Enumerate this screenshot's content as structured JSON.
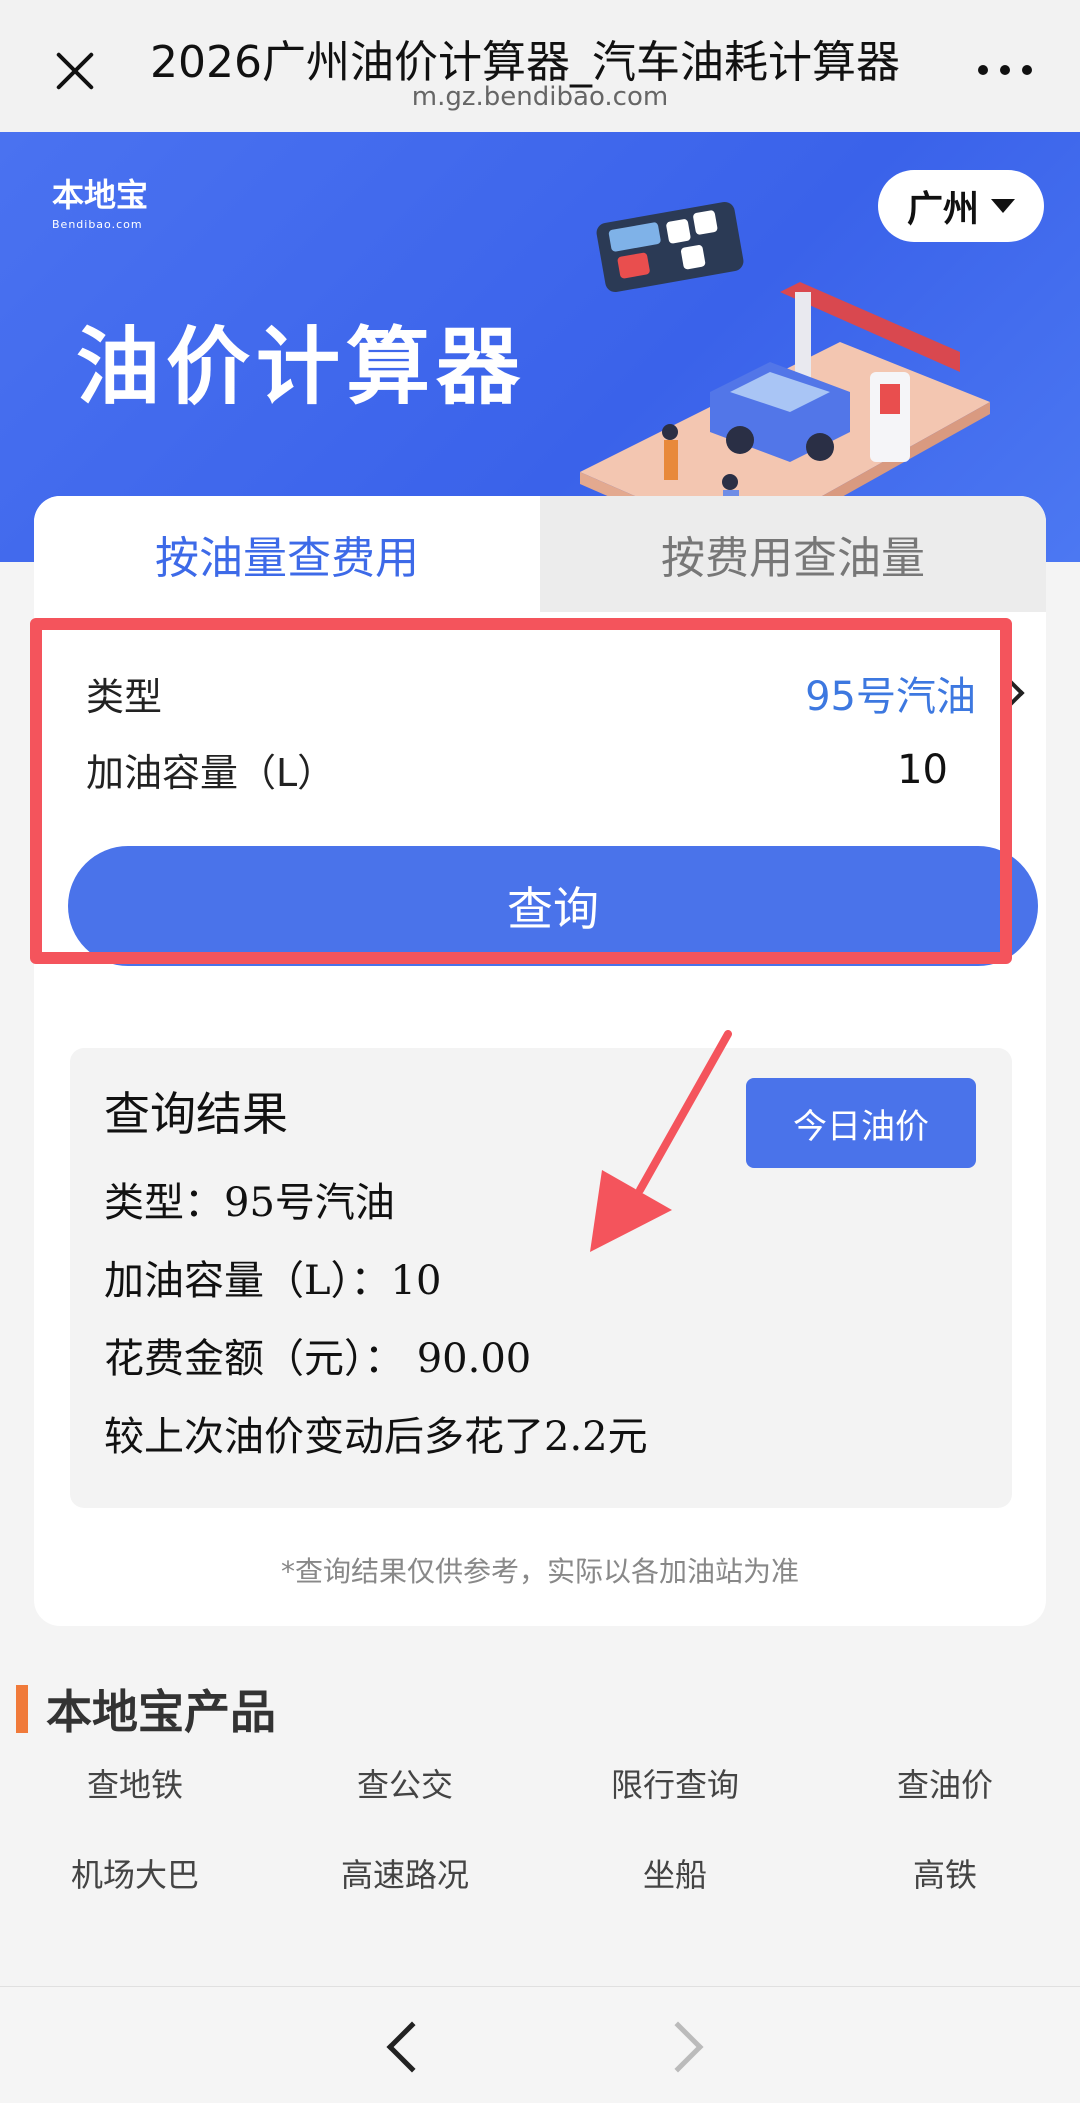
{
  "topbar": {
    "title": "2026广州油价计算器_汽车油耗计算器",
    "url": "m.gz.bendibao.com"
  },
  "banner": {
    "logo_text": "本地宝",
    "logo_sub": "Bendibao.com",
    "title": "油价计算器",
    "city": "广州"
  },
  "tabs": [
    {
      "label": "按油量查费用",
      "active": true
    },
    {
      "label": "按费用查油量",
      "active": false
    }
  ],
  "form": {
    "type_label": "类型",
    "type_value": "95号汽油",
    "volume_label": "加油容量（L）",
    "volume_value": "10",
    "query_button": "查询"
  },
  "result": {
    "title": "查询结果",
    "today_price_button": "今日油价",
    "line_type": "类型：95号汽油",
    "line_volume": "加油容量（L）：10",
    "line_cost": "花费金额（元）： 90.00",
    "line_change": "较上次油价变动后多花了2.2元",
    "note": "*查询结果仅供参考，实际以各加油站为准"
  },
  "products": {
    "title": "本地宝产品",
    "items": [
      "查地铁",
      "查公交",
      "限行查询",
      "查油价",
      "机场大巴",
      "高速路况",
      "坐船",
      "高铁"
    ]
  },
  "colors": {
    "accent": "#4a73ea",
    "highlight": "#f4545c",
    "orange": "#f07a3a"
  }
}
